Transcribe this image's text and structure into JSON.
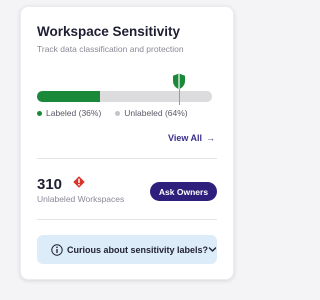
{
  "card": {
    "title": "Workspace Sensitivity",
    "subtitle": "Track data classification and protection"
  },
  "progress": {
    "labeled_fraction": 0.36,
    "target_fraction": 0.81,
    "labeled_color": "#1a8a3a",
    "unlabeled_color": "#dcdcdf"
  },
  "legend": {
    "labeled": "Labeled (36%)",
    "unlabeled": "Unlabeled (64%)"
  },
  "view_all": {
    "label": "View All",
    "arrow": "→"
  },
  "unlabeled": {
    "count": "310",
    "label": "Unlabeled Workspaces",
    "alert_color": "#d9342b"
  },
  "actions": {
    "ask_owners": "Ask Owners",
    "button_color": "#2f1f7d"
  },
  "faq": {
    "label": "Curious about sensitivity labels?",
    "background": "#dcecf8"
  },
  "icons": {
    "shield": "shield-icon",
    "alert": "alert-icon",
    "info": "info-icon",
    "chevron": "chevron-down-icon",
    "arrow": "arrow-right-icon"
  }
}
